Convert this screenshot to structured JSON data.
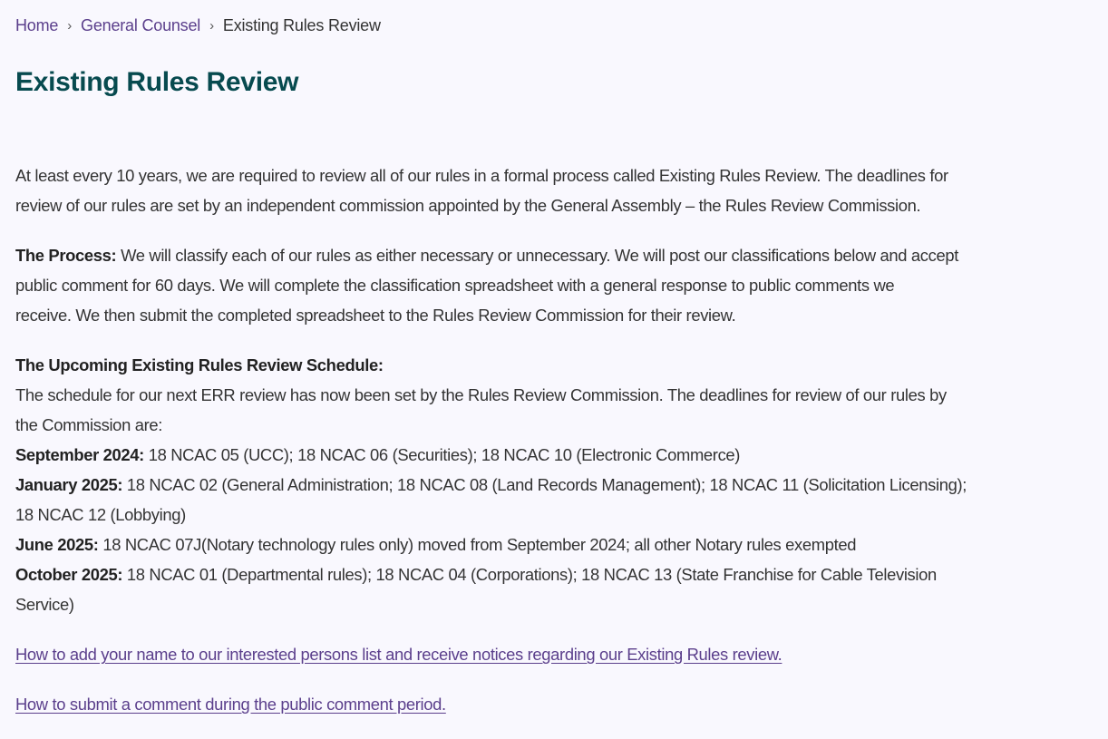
{
  "breadcrumb": {
    "items": [
      {
        "label": "Home",
        "link": true
      },
      {
        "label": "General Counsel",
        "link": true
      },
      {
        "label": "Existing Rules Review",
        "link": false
      }
    ],
    "separator_icon": "chevron-right-icon"
  },
  "page_title": "Existing Rules Review",
  "intro": {
    "lines": [
      "At least every 10 years, we are required to review all of our rules in a formal process called Existing Rules Review. The deadlines for",
      "review of our rules are set by an independent commission appointed by the General Assembly – the Rules Review Commission."
    ]
  },
  "process": {
    "label": "The Process:",
    "lines": [
      " We will classify each of our rules as either necessary or unnecessary. We will post our classifications below and accept",
      "public comment for 60 days. We will complete the classification spreadsheet with a general response to public comments we",
      "receive. We then submit the completed spreadsheet to the Rules Review Commission for their review."
    ]
  },
  "schedule": {
    "heading": "The Upcoming Existing Rules Review Schedule:",
    "intro_lines": [
      "The schedule for our next ERR review has now been set by the Rules Review Commission. The deadlines for review of our rules by",
      "the Commission are:"
    ],
    "entries": [
      {
        "date": "September 2024:",
        "lines": [
          " 18 NCAC 05 (UCC); 18 NCAC 06 (Securities); 18 NCAC 10 (Electronic Commerce)"
        ]
      },
      {
        "date": "January 2025:",
        "lines": [
          " 18 NCAC 02 (General Administration; 18 NCAC 08 (Land Records Management); 18 NCAC 11 (Solicitation Licensing);",
          "18 NCAC 12 (Lobbying)"
        ]
      },
      {
        "date": "June 2025:",
        "lines": [
          " 18 NCAC 07J(Notary technology rules only) moved from September 2024; all other Notary rules exempted"
        ]
      },
      {
        "date": "October 2025:",
        "lines": [
          " 18 NCAC 01 (Departmental rules); 18 NCAC 04 (Corporations); 18 NCAC 13 (State Franchise for Cable Television",
          "Service)"
        ]
      }
    ]
  },
  "links": [
    {
      "label": "How to add your name to our interested persons list and receive notices regarding our Existing Rules review."
    },
    {
      "label": "How to submit a comment during the public comment period."
    }
  ],
  "colors": {
    "background": "#f9f8fe",
    "title": "#074a4f",
    "link": "#5b3f8c",
    "body_text": "#333333"
  }
}
